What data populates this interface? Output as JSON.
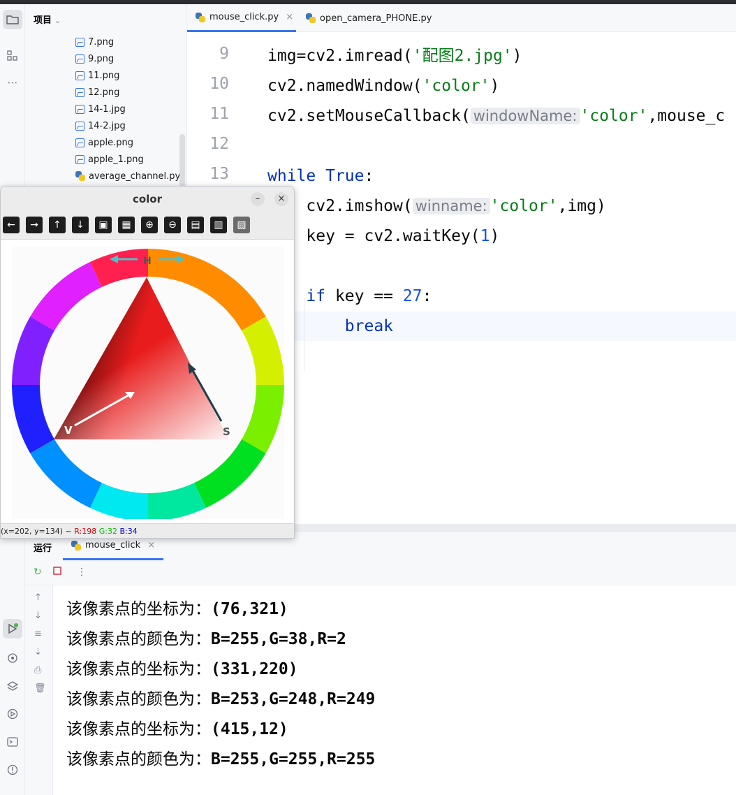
{
  "project": {
    "header": "项目",
    "files": [
      "7.png",
      "9.png",
      "11.png",
      "12.png",
      "14-1.jpg",
      "14-2.jpg",
      "apple.png",
      "apple_1.png",
      "average_channel.py"
    ]
  },
  "tabs": [
    {
      "label": "mouse_click.py",
      "close": "×"
    },
    {
      "label": "open_camera_PHONE.py"
    }
  ],
  "editor": {
    "line_numbers": [
      "9",
      "10",
      "11",
      "12",
      "13"
    ],
    "hints": {
      "window_name": "windowName:",
      "winname": "winname:"
    }
  },
  "color_window": {
    "title": "color",
    "minimize": "–",
    "close": "×",
    "status": {
      "coords": "(x=202, y=134) ~ ",
      "r": "R:198",
      "g": "G:32",
      "b": "B:34"
    },
    "image_labels": {
      "h": "H",
      "v": "V",
      "s": "S"
    }
  },
  "run": {
    "title": "运行",
    "tab_label": "mouse_click",
    "tab_close": "×",
    "console": [
      {
        "prefix": "该像素点的坐标为：",
        "value": "(76,321)"
      },
      {
        "prefix": "该像素点的颜色为：",
        "value": "B=255,G=38,R=2"
      },
      {
        "prefix": "该像素点的坐标为：",
        "value": "(331,220)"
      },
      {
        "prefix": "该像素点的颜色为：",
        "value": "B=253,G=248,R=249"
      },
      {
        "prefix": "该像素点的坐标为：",
        "value": "(415,12)"
      },
      {
        "prefix": "该像素点的颜色为：",
        "value": "B=255,G=255,R=255"
      }
    ]
  }
}
